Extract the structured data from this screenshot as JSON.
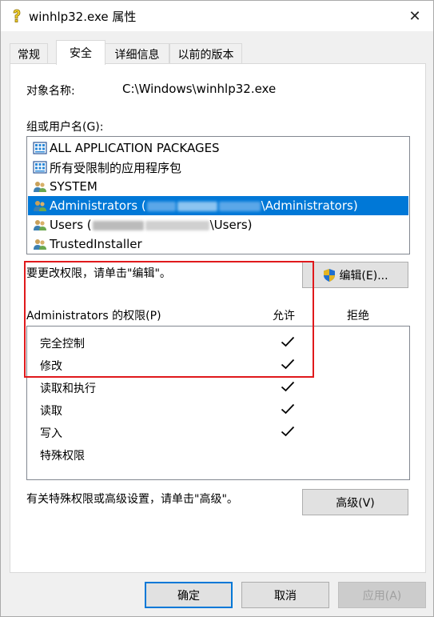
{
  "window": {
    "title": "winhlp32.exe 属性",
    "close_glyph": "✕"
  },
  "tabs": [
    "常规",
    "安全",
    "详细信息",
    "以前的版本"
  ],
  "object": {
    "label": "对象名称:",
    "value": "C:\\Windows\\winhlp32.exe"
  },
  "groups": {
    "label": "组或用户名(G):",
    "items": [
      {
        "label": "ALL APPLICATION PACKAGES",
        "icon": "app-package-icon"
      },
      {
        "label": "所有受限制的应用程序包",
        "icon": "app-package-icon"
      },
      {
        "label": "SYSTEM",
        "icon": "users-icon"
      },
      {
        "prefix": "Administrators (",
        "suffix": "\\Administrators)",
        "icon": "users-icon",
        "selected": true
      },
      {
        "prefix": "Users (",
        "suffix": "\\Users)",
        "icon": "users-icon"
      },
      {
        "label": "TrustedInstaller",
        "icon": "users-icon"
      }
    ]
  },
  "edit": {
    "hint": "要更改权限，请单击\"编辑\"。",
    "button": "编辑(E)..."
  },
  "permissions": {
    "label": "Administrators 的权限(P)",
    "allow_header": "允许",
    "deny_header": "拒绝",
    "rows": [
      {
        "name": "完全控制",
        "allow": true
      },
      {
        "name": "修改",
        "allow": true
      },
      {
        "name": "读取和执行",
        "allow": true
      },
      {
        "name": "读取",
        "allow": true
      },
      {
        "name": "写入",
        "allow": true
      },
      {
        "name": "特殊权限",
        "allow": false
      }
    ]
  },
  "advanced": {
    "hint": "有关特殊权限或高级设置，请单击\"高级\"。",
    "button": "高级(V)"
  },
  "footer": {
    "ok": "确定",
    "cancel": "取消",
    "apply": "应用(A)"
  },
  "colors": {
    "selection": "#0078d7",
    "highlight_box": "#e0191c"
  }
}
